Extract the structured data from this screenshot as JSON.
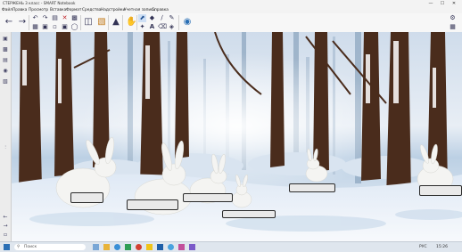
{
  "window": {
    "title": "СТЕРЖЕНЬ 3 класс - SMART Notebook",
    "min_glyph": "—",
    "max_glyph": "☐",
    "close_glyph": "✕"
  },
  "menu": [
    "Файл",
    "Правка",
    "Просмотр",
    "Вставка",
    "Формат",
    "Средства",
    "Надстройки",
    "Учетная запись",
    "Справка"
  ],
  "taskbar": {
    "search_placeholder": "Поиск",
    "language": "РУС",
    "time": "15:26"
  },
  "colors": {
    "accent": "#2a6fb5",
    "box_border": "#2b2b2b",
    "box_fill": "#e9e9e9",
    "snow_sky": "#dfe9f3"
  },
  "icons": {
    "toolbar": [
      "arrow-left-icon",
      "arrow-right-icon",
      "undo-icon",
      "redo-icon",
      "paste-icon",
      "delete-icon",
      "screen-shade-icon",
      "table-icon",
      "display-icon",
      "add-page-icon",
      "save-icon",
      "document-camera-icon",
      "addons-icon",
      "select-icon",
      "shapes-icon",
      "pen-icon",
      "eraser-icon",
      "text-icon",
      "line-icon",
      "fill-icon",
      "magic-pen-icon",
      "properties-icon",
      "settings-icon"
    ],
    "sidebar": [
      "page-sorter-icon",
      "gallery-icon",
      "attachments-icon",
      "properties-icon",
      "addons-icon"
    ]
  }
}
